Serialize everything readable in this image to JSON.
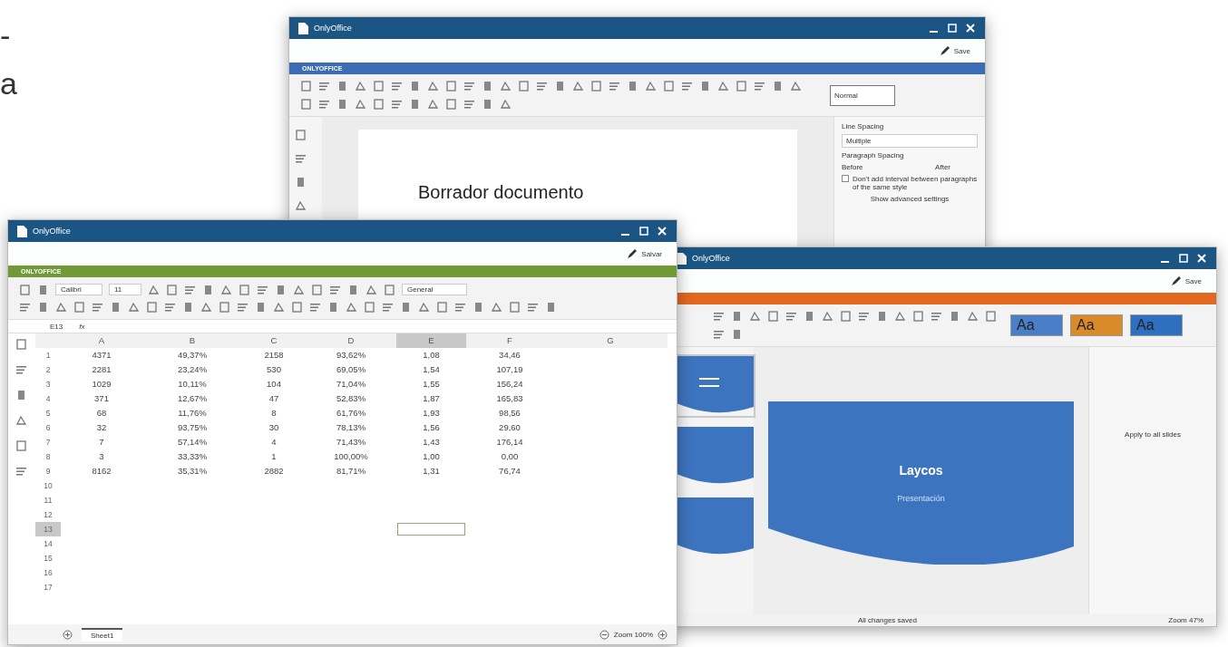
{
  "edge_texts": [
    "-",
    "a"
  ],
  "document": {
    "title": "OnlyOffice",
    "save": "Save",
    "brand": "ONLYOFFICE",
    "style_box": "Normal",
    "body": "Borrador documento",
    "panel": [
      {
        "kind": "heading",
        "text": "Line Spacing"
      },
      {
        "kind": "field",
        "text": "Multiple"
      },
      {
        "kind": "heading",
        "text": "Paragraph Spacing"
      },
      {
        "kind": "pair",
        "text": "Before",
        "text2": "After"
      },
      {
        "kind": "check",
        "text": "Don't add interval between paragraphs of the same style",
        "checked": false
      },
      {
        "kind": "link",
        "text": "Show advanced settings"
      }
    ]
  },
  "presentation": {
    "title": "OnlyOffice",
    "save": "Save",
    "slide_title": "Laycos",
    "slide_subtitle": "Presentación",
    "status": "All changes saved",
    "zoom": "Zoom 47%",
    "apply": "Apply to all slides",
    "themes": [
      {
        "label": "Aa",
        "color": "#4a7fc8"
      },
      {
        "label": "Aa",
        "color": "#d98a2b"
      },
      {
        "label": "Aa",
        "color": "#2f6fc0"
      }
    ],
    "thumbnails": [
      {
        "selected": true
      },
      {
        "selected": false
      },
      {
        "selected": false
      }
    ]
  },
  "spreadsheet": {
    "title": "OnlyOffice",
    "save": "Salvar",
    "brand": "ONLYOFFICE",
    "font": "Calibri",
    "size": "11",
    "format": "General",
    "cell": "E13",
    "fx": "fx",
    "columns": [
      {
        "label": "A",
        "selected": false
      },
      {
        "label": "B",
        "selected": false
      },
      {
        "label": "C",
        "selected": false
      },
      {
        "label": "D",
        "selected": false
      },
      {
        "label": "E",
        "selected": true
      },
      {
        "label": "F",
        "selected": false
      },
      {
        "label": "G",
        "selected": false
      }
    ],
    "rows": [
      {
        "label": "1",
        "selected": false,
        "cells": [
          "4371",
          "49,37%",
          "2158",
          "93,62%",
          "1,08",
          "34,46"
        ]
      },
      {
        "label": "2",
        "selected": false,
        "cells": [
          "2281",
          "23,24%",
          "530",
          "69,05%",
          "1,54",
          "107,19"
        ]
      },
      {
        "label": "3",
        "selected": false,
        "cells": [
          "1029",
          "10,11%",
          "104",
          "71,04%",
          "1,55",
          "156,24"
        ]
      },
      {
        "label": "4",
        "selected": false,
        "cells": [
          "371",
          "12,67%",
          "47",
          "52,83%",
          "1,87",
          "165,83"
        ]
      },
      {
        "label": "5",
        "selected": false,
        "cells": [
          "68",
          "11,76%",
          "8",
          "61,76%",
          "1,93",
          "98,56"
        ]
      },
      {
        "label": "6",
        "selected": false,
        "cells": [
          "32",
          "93,75%",
          "30",
          "78,13%",
          "1,56",
          "29,60"
        ]
      },
      {
        "label": "7",
        "selected": false,
        "cells": [
          "7",
          "57,14%",
          "4",
          "71,43%",
          "1,43",
          "176,14"
        ]
      },
      {
        "label": "8",
        "selected": false,
        "cells": [
          "3",
          "33,33%",
          "1",
          "100,00%",
          "1,00",
          "0,00"
        ]
      },
      {
        "label": "9",
        "selected": false,
        "cells": [
          "8162",
          "35,31%",
          "2882",
          "81,71%",
          "1,31",
          "76,74"
        ]
      },
      {
        "label": "10",
        "selected": false,
        "cells": []
      },
      {
        "label": "11",
        "selected": false,
        "cells": []
      },
      {
        "label": "12",
        "selected": false,
        "cells": []
      },
      {
        "label": "13",
        "selected": true,
        "cells": []
      },
      {
        "label": "14",
        "selected": false,
        "cells": []
      },
      {
        "label": "15",
        "selected": false,
        "cells": []
      },
      {
        "label": "16",
        "selected": false,
        "cells": []
      },
      {
        "label": "17",
        "selected": false,
        "cells": []
      }
    ],
    "sheet_tab": "Sheet1",
    "zoom": "Zoom 100%"
  }
}
